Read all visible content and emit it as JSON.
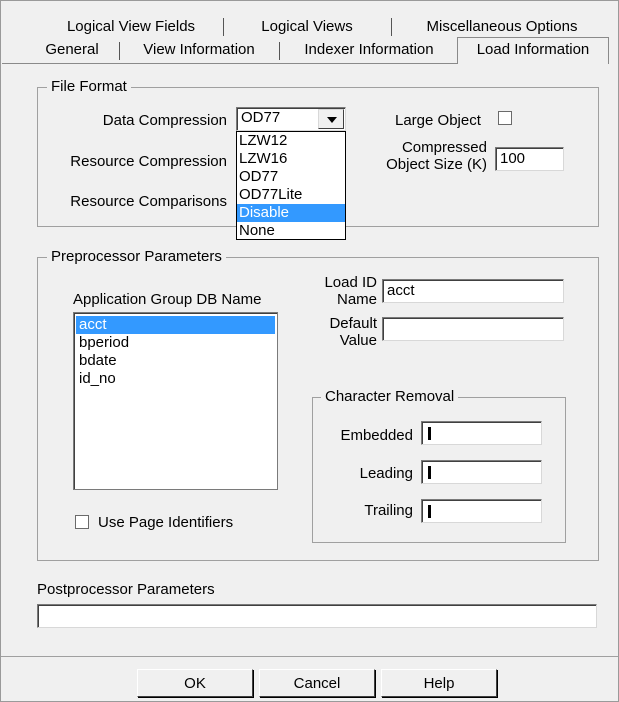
{
  "tabs": {
    "row_back": [
      "Logical View Fields",
      "Logical Views",
      "Miscellaneous Options"
    ],
    "row_front": [
      "General",
      "View Information",
      "Indexer Information",
      "Load Information"
    ],
    "active": "Load Information"
  },
  "file_format": {
    "title": "File Format",
    "data_compression_label": "Data Compression",
    "data_compression_value": "OD77",
    "dropdown_options": [
      "LZW12",
      "LZW16",
      "OD77",
      "OD77Lite",
      "Disable",
      "None"
    ],
    "dropdown_highlighted": "Disable",
    "resource_compression_label": "Resource Compression",
    "resource_comparisons_label": "Resource Comparisons",
    "large_object_label": "Large Object",
    "large_object_checked": false,
    "compressed_size_label_1": "Compressed",
    "compressed_size_label_2": "Object Size (K)",
    "compressed_size_value": "100"
  },
  "preprocessor": {
    "title": "Preprocessor Parameters",
    "app_group_label": "Application Group DB Name",
    "app_group_items": [
      "acct",
      "bperiod",
      "bdate",
      "id_no"
    ],
    "app_group_selected": "acct",
    "load_id_label_1": "Load ID",
    "load_id_label_2": "Name",
    "load_id_value": "acct",
    "default_label_1": "Default",
    "default_label_2": "Value",
    "default_value": "",
    "use_page_identifiers_label": "Use Page Identifiers",
    "use_page_identifiers_checked": false,
    "char_removal": {
      "title": "Character Removal",
      "embedded_label": "Embedded",
      "leading_label": "Leading",
      "trailing_label": "Trailing"
    }
  },
  "postprocessor": {
    "label": "Postprocessor Parameters",
    "value": ""
  },
  "buttons": {
    "ok": "OK",
    "cancel": "Cancel",
    "help": "Help"
  },
  "colors": {
    "selection": "#3399ff",
    "dialog_bg": "#f0f0f0"
  }
}
